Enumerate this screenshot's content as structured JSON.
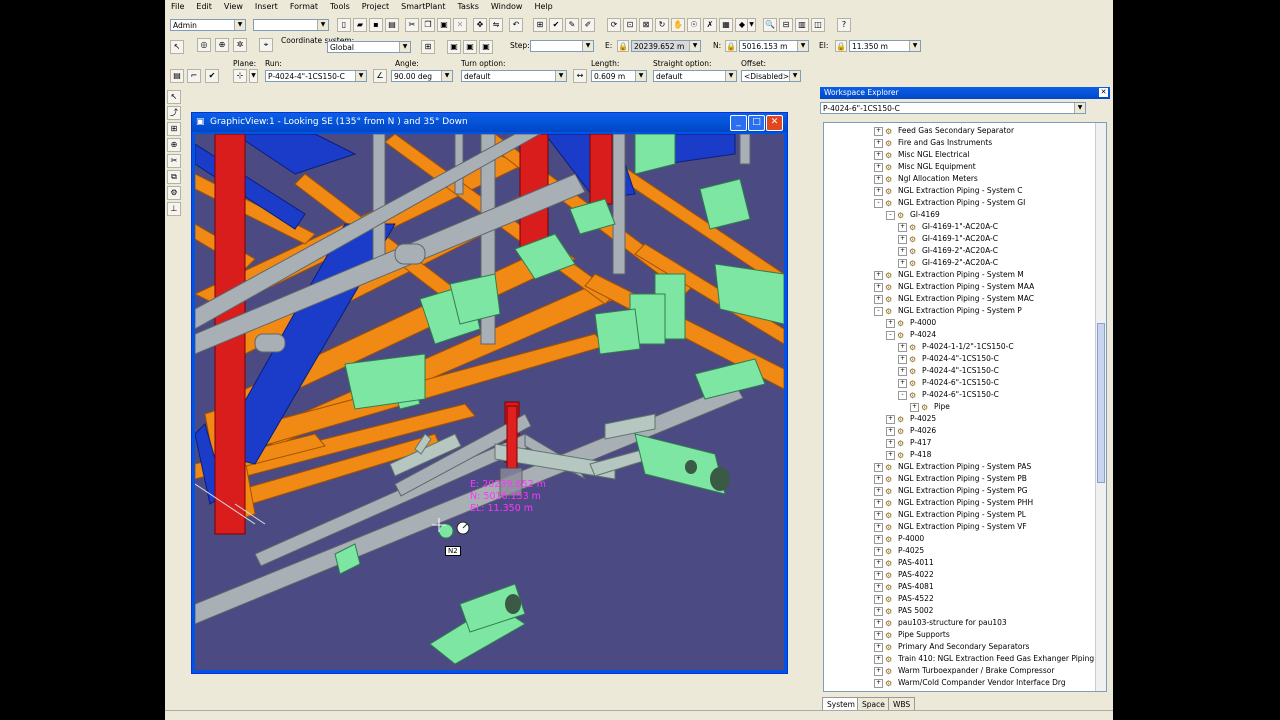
{
  "menu": [
    "File",
    "Edit",
    "View",
    "Insert",
    "Format",
    "Tools",
    "Project",
    "SmartPlant",
    "Tasks",
    "Window",
    "Help"
  ],
  "toolbar": {
    "permission_group": "Admin",
    "coordinate_system_label": "Coordinate system:",
    "coordinate_system": "Global",
    "step_label": "Step:",
    "e_label": "E:",
    "e_value": "20239.652 m",
    "n_label": "N:",
    "n_value": "5016.153 m",
    "el_label": "El:",
    "el_value": "11.350 m",
    "plane_label": "Plane:",
    "run_label": "Run:",
    "run_value": "P-4024-4\"-1CS150-C",
    "angle_label": "Angle:",
    "angle_value": "90.00 deg",
    "turn_label": "Turn option:",
    "turn_value": "default",
    "length_label": "Length:",
    "length_value": "0.609 m",
    "straight_label": "Straight option:",
    "straight_value": "default",
    "offset_label": "Offset:",
    "offset_value": "<Disabled>"
  },
  "graphic_view": {
    "title": "GraphicView:1 - Looking SE (135° from N ) and 35° Down",
    "readout_e": "E: 20239.652 m",
    "readout_n": "N: 5016.153 m",
    "readout_el": "EL: 11.350 m",
    "tag": "N2"
  },
  "workspace_explorer": {
    "title": "Workspace Explorer",
    "filter": "P-4024-6\"-1CS150-C",
    "tabs": [
      "System",
      "Space",
      "WBS"
    ],
    "nodes": [
      {
        "label": "Feed Gas Secondary Separator",
        "level": 0,
        "exp": "+"
      },
      {
        "label": "Fire and Gas Instruments",
        "level": 0,
        "exp": "+"
      },
      {
        "label": "Misc NGL Electrical",
        "level": 0,
        "exp": "+"
      },
      {
        "label": "Misc NGL Equipment",
        "level": 0,
        "exp": "+"
      },
      {
        "label": "Ngl Allocation Meters",
        "level": 0,
        "exp": "+"
      },
      {
        "label": "NGL Extraction Piping - System C",
        "level": 0,
        "exp": "+"
      },
      {
        "label": "NGL Extraction Piping - System GI",
        "level": 0,
        "exp": "-"
      },
      {
        "label": "GI-4169",
        "level": 1,
        "exp": "-"
      },
      {
        "label": "GI-4169-1\"-AC20A-C",
        "level": 2,
        "exp": "+"
      },
      {
        "label": "GI-4169-1\"-AC20A-C",
        "level": 2,
        "exp": "+"
      },
      {
        "label": "GI-4169-2\"-AC20A-C",
        "level": 2,
        "exp": "+"
      },
      {
        "label": "GI-4169-2\"-AC20A-C",
        "level": 2,
        "exp": "+"
      },
      {
        "label": "NGL Extraction Piping - System M",
        "level": 0,
        "exp": "+"
      },
      {
        "label": "NGL Extraction Piping - System MAA",
        "level": 0,
        "exp": "+"
      },
      {
        "label": "NGL Extraction Piping - System MAC",
        "level": 0,
        "exp": "+"
      },
      {
        "label": "NGL Extraction Piping - System P",
        "level": 0,
        "exp": "-"
      },
      {
        "label": "P-4000",
        "level": 1,
        "exp": "+"
      },
      {
        "label": "P-4024",
        "level": 1,
        "exp": "-"
      },
      {
        "label": "P-4024-1-1/2\"-1CS150-C",
        "level": 2,
        "exp": "+"
      },
      {
        "label": "P-4024-4\"-1CS150-C",
        "level": 2,
        "exp": "+"
      },
      {
        "label": "P-4024-4\"-1CS150-C",
        "level": 2,
        "exp": "+"
      },
      {
        "label": "P-4024-6\"-1CS150-C",
        "level": 2,
        "exp": "+"
      },
      {
        "label": "P-4024-6\"-1CS150-C",
        "level": 2,
        "exp": "-"
      },
      {
        "label": "Pipe",
        "level": 3,
        "exp": "+"
      },
      {
        "label": "P-4025",
        "level": 1,
        "exp": "+"
      },
      {
        "label": "P-4026",
        "level": 1,
        "exp": "+"
      },
      {
        "label": "P-417",
        "level": 1,
        "exp": "+"
      },
      {
        "label": "P-418",
        "level": 1,
        "exp": "+"
      },
      {
        "label": "NGL Extraction Piping - System PAS",
        "level": 0,
        "exp": "+"
      },
      {
        "label": "NGL Extraction Piping - System PB",
        "level": 0,
        "exp": "+"
      },
      {
        "label": "NGL Extraction Piping - System PG",
        "level": 0,
        "exp": "+"
      },
      {
        "label": "NGL Extraction Piping - System PHH",
        "level": 0,
        "exp": "+"
      },
      {
        "label": "NGL Extraction Piping - System PL",
        "level": 0,
        "exp": "+"
      },
      {
        "label": "NGL Extraction Piping - System VF",
        "level": 0,
        "exp": "+"
      },
      {
        "label": "P-4000",
        "level": 0,
        "exp": "+"
      },
      {
        "label": "P-4025",
        "level": 0,
        "exp": "+"
      },
      {
        "label": "PAS-4011",
        "level": 0,
        "exp": "+"
      },
      {
        "label": "PAS-4022",
        "level": 0,
        "exp": "+"
      },
      {
        "label": "PAS-4081",
        "level": 0,
        "exp": "+"
      },
      {
        "label": "PAS-4522",
        "level": 0,
        "exp": "+"
      },
      {
        "label": "PAS 5002",
        "level": 0,
        "exp": "+"
      },
      {
        "label": "pau103-structure for pau103",
        "level": 0,
        "exp": "+"
      },
      {
        "label": "Pipe Supports",
        "level": 0,
        "exp": "+"
      },
      {
        "label": "Primary And Secondary Separators",
        "level": 0,
        "exp": "+"
      },
      {
        "label": "Train 410: NGL Extraction Feed Gas Exhanger Piping",
        "level": 0,
        "exp": "+"
      },
      {
        "label": "Warm Turboexpander / Brake Compressor",
        "level": 0,
        "exp": "+"
      },
      {
        "label": "Warm/Cold Compander Vendor Interface Drg",
        "level": 0,
        "exp": "+"
      }
    ]
  }
}
